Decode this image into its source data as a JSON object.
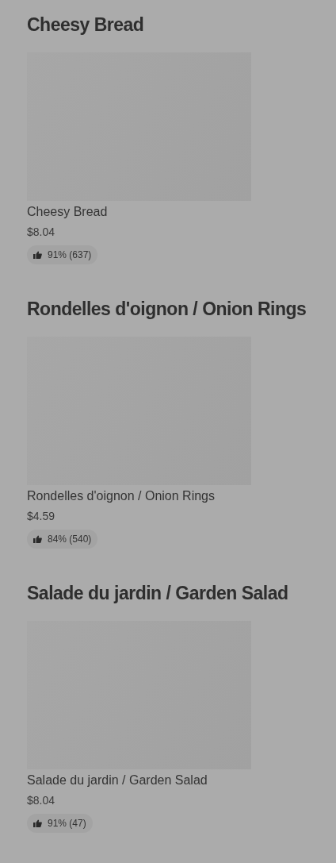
{
  "sections": [
    {
      "heading": "Cheesy Bread",
      "items": [
        {
          "name": "Cheesy Bread",
          "price": "$8.04",
          "rating": "91% (637)"
        }
      ]
    },
    {
      "heading": "Rondelles d'oignon / Onion Rings",
      "items": [
        {
          "name": "Rondelles d'oignon / Onion Rings",
          "price": "$4.59",
          "rating": "84% (540)"
        }
      ]
    },
    {
      "heading": "Salade du jardin / Garden Salad",
      "items": [
        {
          "name": "Salade du jardin / Garden Salad",
          "price": "$8.04",
          "rating": "91% (47)"
        }
      ]
    }
  ]
}
